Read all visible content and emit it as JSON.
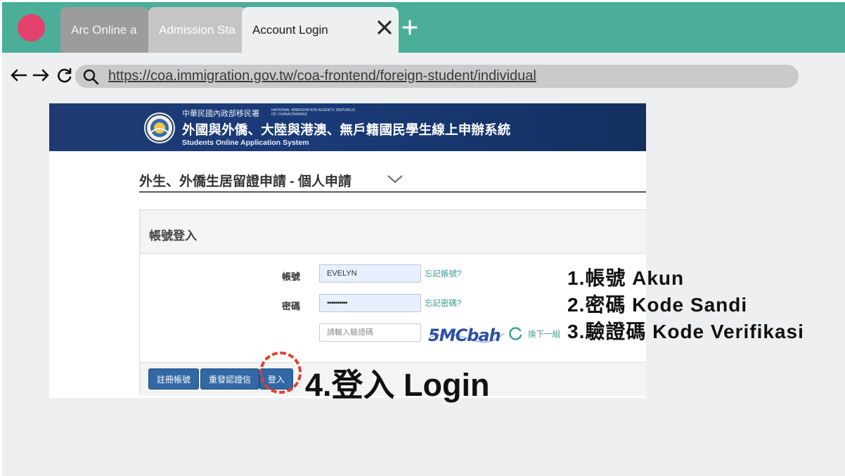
{
  "browser": {
    "tabs": [
      {
        "label": "Arc Online a"
      },
      {
        "label": "Admission Sta"
      },
      {
        "label": "Account Login"
      }
    ],
    "url": "https://coa.immigration.gov.tw/coa-frontend/foreign-student/individual",
    "colors": {
      "tabbar": "#4aae98",
      "dot": "#e2416c"
    }
  },
  "site": {
    "agency_cn": "中華民國內政部移民署",
    "agency_en": "NATIONAL IMMIGRATION AGENCY, REPUBLIC OF CHINA(TAIWAN)",
    "system_cn": "外國與外僑、大陸與港澳、無戶籍國民學生線上申辦系統",
    "system_en": "Students Online Application System"
  },
  "page": {
    "title": "外生、外僑生居留證申請 - 個人申請",
    "panel_title": "帳號登入",
    "account_label": "帳號",
    "account_value": "EVELYN",
    "forgot_account": "忘記帳號?",
    "password_label": "密碼",
    "password_value": "••••••••••",
    "forgot_password": "忘記密碼?",
    "captcha_placeholder": "請輸入驗證碼",
    "captcha_text": "5MCbah",
    "refresh_label": "換下一組",
    "buttons": {
      "register": "註冊帳號",
      "resend": "重發認證信",
      "login": "登入"
    }
  },
  "annotations": {
    "step1": "1.帳號 Akun",
    "step2": "2.密碼 Kode Sandi",
    "step3": "3.驗證碼 Kode Verifikasi",
    "step4": "4.登入 Login"
  }
}
